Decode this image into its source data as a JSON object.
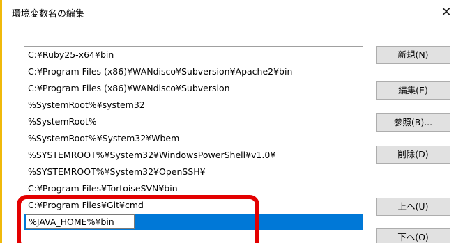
{
  "window": {
    "title": "環境変数名の編集",
    "close_glyph": "✕"
  },
  "list": {
    "items": [
      "C:¥Ruby25-x64¥bin",
      "C:¥Program Files (x86)¥WANdisco¥Subversion¥Apache2¥bin",
      "C:¥Program Files (x86)¥WANdisco¥Subversion",
      "%SystemRoot%¥system32",
      "%SystemRoot%",
      "%SystemRoot%¥System32¥Wbem",
      "%SYSTEMROOT%¥System32¥WindowsPowerShell¥v1.0¥",
      "%SYSTEMROOT%¥System32¥OpenSSH¥",
      "C:¥Program Files¥TortoiseSVN¥bin",
      "C:¥Program Files¥Git¥cmd"
    ],
    "editing_value": "%JAVA_HOME%¥bin",
    "selection_color": "#0078d7"
  },
  "buttons": {
    "new": "新規(N)",
    "edit": "編集(E)",
    "browse": "参照(B)...",
    "delete": "削除(D)",
    "move_up": "上へ(U)",
    "move_down": "下へ(O)"
  },
  "annotation": {
    "color": "#e30000"
  }
}
